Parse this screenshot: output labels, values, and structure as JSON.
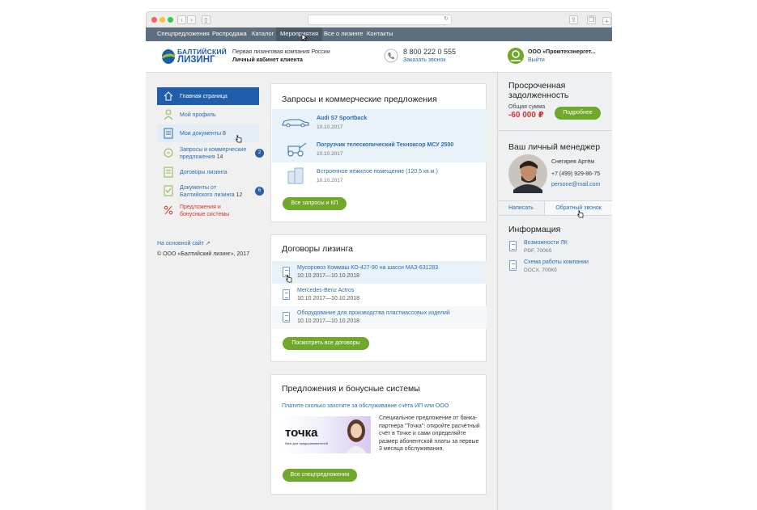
{
  "topnav": {
    "items": [
      "Спецпредложения",
      "Распродажа",
      "Каталог",
      "Мероприятия",
      "Все о лизинге",
      "Контакты"
    ]
  },
  "header": {
    "logo_line1": "БАЛТИЙСКИЙ",
    "logo_line2": "ЛИЗИНГ",
    "tagline1": "Первая лизинговая компания России",
    "tagline2": "Личный кабинет клиента",
    "phone": "8 800 222 0 555",
    "callback": "Заказать звонок",
    "company": "ООО «Промтехэнергет...",
    "logout": "Выйти"
  },
  "sidebar": {
    "items": [
      {
        "label": "Главная страница"
      },
      {
        "label": "Мой профиль"
      },
      {
        "label": "Мои документы",
        "count": "8"
      },
      {
        "label": "Запросы и коммерческие предложения",
        "count": "14",
        "badge": "2"
      },
      {
        "label": "Договоры лизинга"
      },
      {
        "label": "Документы от Балтийского лизинга",
        "count": "12",
        "badge": "6"
      },
      {
        "label": "Предложения и бонусные системы"
      }
    ],
    "main_site": "На основной сайт",
    "copyright": "© ООО «Балтийский лизинг», 2017"
  },
  "requests": {
    "title": "Запросы и коммерческие предложения",
    "rows": [
      {
        "title": "Audi S7 Sportback",
        "date": "10.10.2017"
      },
      {
        "title": "Погрузчик телескопический Техноксор МСУ 2500",
        "date": "10.10.2017"
      },
      {
        "title": "Встроенное нежилое помещение (120,5 кв.м.)",
        "date": "10.10.2017"
      }
    ],
    "button": "Все запросы и КП"
  },
  "contracts": {
    "title": "Договоры лизинга",
    "rows": [
      {
        "title": "Мусоровоз Коммаш КО-427-90 на шасси МАЗ-631283",
        "date": "10.10.2017—10.10.2018"
      },
      {
        "title": "Mercedes-Benz Actros",
        "date": "10.10.2017—10.10.2018"
      },
      {
        "title": "Оборудование для производства пластмассовых изделий",
        "date": "10.10.2017—10.10.2018"
      }
    ],
    "button": "Посмотреть все договоры"
  },
  "offers": {
    "title": "Предложения и бонусные системы",
    "link": "Платите сколько захотите за обслуживание счёта ИП или ООО",
    "banner_brand": "точка",
    "banner_sub": "банк для предпринимателей",
    "text": "Специальное предложение от банка-партнера \"Точка\": откройте расчётный счёт в Точке и сами определяйте размер абонентской платы за первые 3 месяца обслуживания.",
    "button": "Все спецпредложения"
  },
  "overdue": {
    "title": "Просроченная задолженность",
    "sum_label": "Общая сумма",
    "sum": "-60 000 ₽",
    "button": "Подробнее"
  },
  "manager": {
    "title": "Ваш личный менеджер",
    "name": "Снегирев Артём",
    "phone": "+7 (499) 929-86-75",
    "email": "persone@mail.com",
    "write": "Написать",
    "callback": "Обратный звонок"
  },
  "info": {
    "title": "Информация",
    "items": [
      {
        "title": "Возможности ЛК",
        "meta": "PDF, 700Кб"
      },
      {
        "title": "Схема работы компании",
        "meta": "DOCX, 700Кб"
      }
    ]
  },
  "colors": {
    "nav_bg": "#5d6f7e",
    "accent_blue": "#2a6db0",
    "active_side": "#1f5ea8",
    "green": "#6fa82a",
    "debt_red": "#d9302a"
  }
}
